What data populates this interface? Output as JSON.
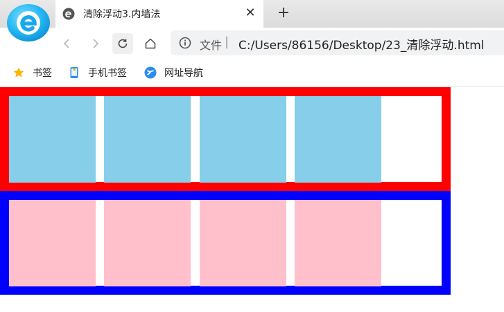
{
  "tab": {
    "title": "清除浮动3.内墙法",
    "close_label": "✕"
  },
  "new_tab_label": "+",
  "address": {
    "scheme_label": "文件",
    "separator": "|",
    "url": "C:/Users/86156/Desktop/23_清除浮动.html"
  },
  "bookmarks": [
    {
      "label": "书签",
      "icon": "star-icon"
    },
    {
      "label": "手机书签",
      "icon": "phone-bookmark-icon"
    },
    {
      "label": "网址导航",
      "icon": "site-nav-icon"
    }
  ],
  "page": {
    "boxes": [
      {
        "border_color": "#ff0000",
        "float_color": "#87ceeb",
        "float_count": 4
      },
      {
        "border_color": "#0000ff",
        "float_color": "#ffc0cb",
        "float_count": 4
      }
    ]
  },
  "colors": {
    "accent": "#2a9df4",
    "tabstrip": "#dedede"
  }
}
